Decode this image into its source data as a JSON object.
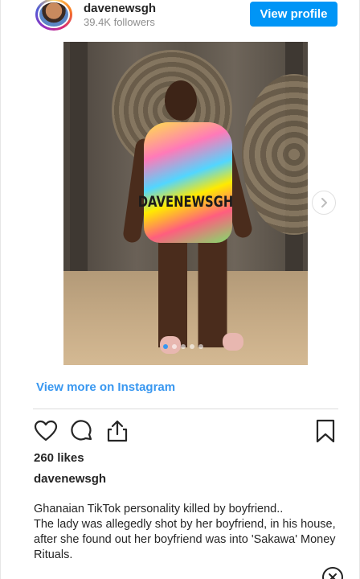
{
  "header": {
    "username": "davenewsgh",
    "followers": "39.4K followers",
    "view_profile_label": "View profile"
  },
  "post": {
    "watermark": "DAVENEWSGH",
    "carousel": {
      "slide_count": 5,
      "active_index": 0
    },
    "view_more_label": "View more on Instagram",
    "likes": "260 likes",
    "caption_user": "davenewsgh",
    "caption_lines": [
      "Ghanaian TikTok personality killed by boyfriend..",
      "The lady was allegedly shot by her boyfriend, in his house, after she found out her boyfriend was into 'Sakawa' Money Rituals."
    ]
  },
  "icons": {
    "like": "heart-outline-icon",
    "comment": "speech-bubble-icon",
    "share": "share-upload-icon",
    "save": "bookmark-icon",
    "next": "chevron-right-icon",
    "close": "close-icon"
  },
  "colors": {
    "accent": "#0095f6",
    "link": "#3897f0",
    "text": "#262626",
    "muted": "#8e8e8e"
  }
}
